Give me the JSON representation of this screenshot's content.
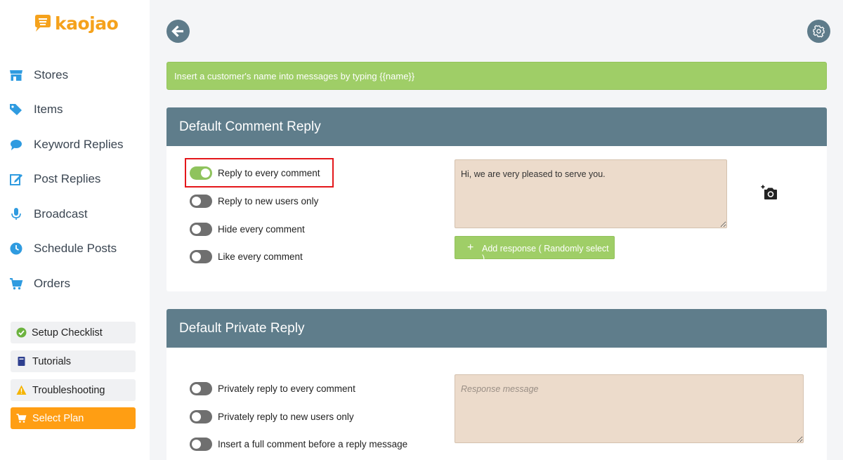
{
  "brand": {
    "name": "kaojao",
    "color": "#f5a21c"
  },
  "sidebar": {
    "items": [
      {
        "label": "Stores",
        "icon": "store-icon"
      },
      {
        "label": "Items",
        "icon": "tags-icon"
      },
      {
        "label": "Keyword Replies",
        "icon": "speech-bubble-icon"
      },
      {
        "label": "Post Replies",
        "icon": "edit-icon"
      },
      {
        "label": "Broadcast",
        "icon": "microphone-icon"
      },
      {
        "label": "Schedule Posts",
        "icon": "clock-icon"
      },
      {
        "label": "Orders",
        "icon": "cart-icon"
      }
    ],
    "buttons": [
      {
        "label": "Setup Checklist",
        "icon": "check-circle-icon"
      },
      {
        "label": "Tutorials",
        "icon": "book-icon"
      },
      {
        "label": "Troubleshooting",
        "icon": "warning-icon"
      },
      {
        "label": "Select Plan",
        "icon": "cart-icon"
      }
    ],
    "accent_color": "#2f9be0"
  },
  "info_bar": {
    "text": "Insert a customer's name into messages by typing {{name}}"
  },
  "comment_reply": {
    "title": "Default Comment Reply",
    "toggles": [
      {
        "label": "Reply to every comment",
        "on": true
      },
      {
        "label": "Reply to new users only",
        "on": false
      },
      {
        "label": "Hide every comment",
        "on": false
      },
      {
        "label": "Like every comment",
        "on": false
      }
    ],
    "message": "Hi, we are very pleased to serve you.",
    "add_response_label": "Add response ( Randomly select )"
  },
  "private_reply": {
    "title": "Default Private Reply",
    "toggles": [
      {
        "label": "Privately reply to every comment",
        "on": false
      },
      {
        "label": "Privately reply to new users only",
        "on": false
      },
      {
        "label": "Insert a full comment before a reply message",
        "on": false
      }
    ],
    "message_placeholder": "Response message"
  },
  "colors": {
    "header": "#5f7d8b",
    "info_green": "#9fce67",
    "toggle_on": "#8fc35d",
    "toggle_off": "#6f6f6f",
    "plan_orange": "#ff9e13",
    "textarea_bg": "#ecdbcb",
    "highlight_red": "#e4171b"
  }
}
